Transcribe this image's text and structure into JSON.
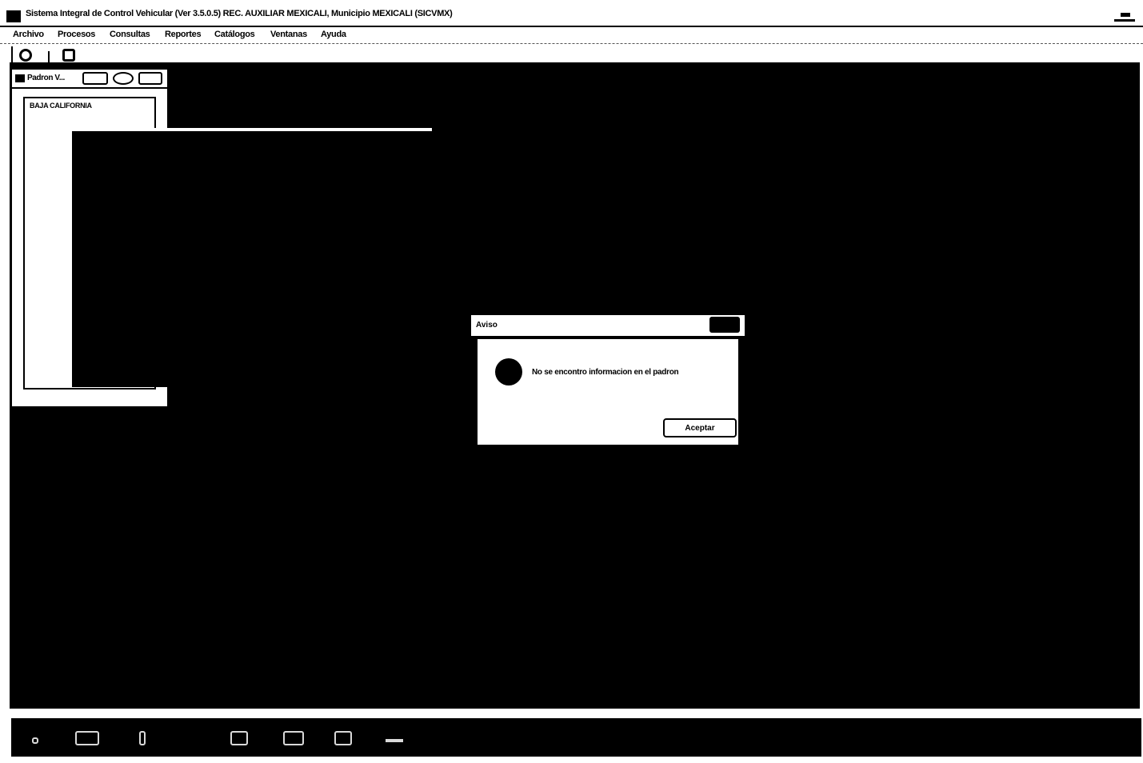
{
  "window": {
    "title": "Sistema Integral de Control Vehicular (Ver 3.5.0.5) REC. AUXILIAR MEXICALI, Municipio MEXICALI (SICVMX)"
  },
  "menu": {
    "items": [
      {
        "label": "Archivo"
      },
      {
        "label": "Procesos"
      },
      {
        "label": "Consultas"
      },
      {
        "label": "Reportes"
      },
      {
        "label": "Catálogos"
      },
      {
        "label": "Ventanas"
      },
      {
        "label": "Ayuda"
      }
    ]
  },
  "padron_window": {
    "title": "Padron V...",
    "list_items": [
      "BAJA CALIFORNIA"
    ]
  },
  "dialog": {
    "title": "Aviso",
    "message": "No se encontro informacion en el padron",
    "button_label": "Aceptar"
  },
  "colors": {
    "desktop": "#000000",
    "window": "#ffffff"
  }
}
